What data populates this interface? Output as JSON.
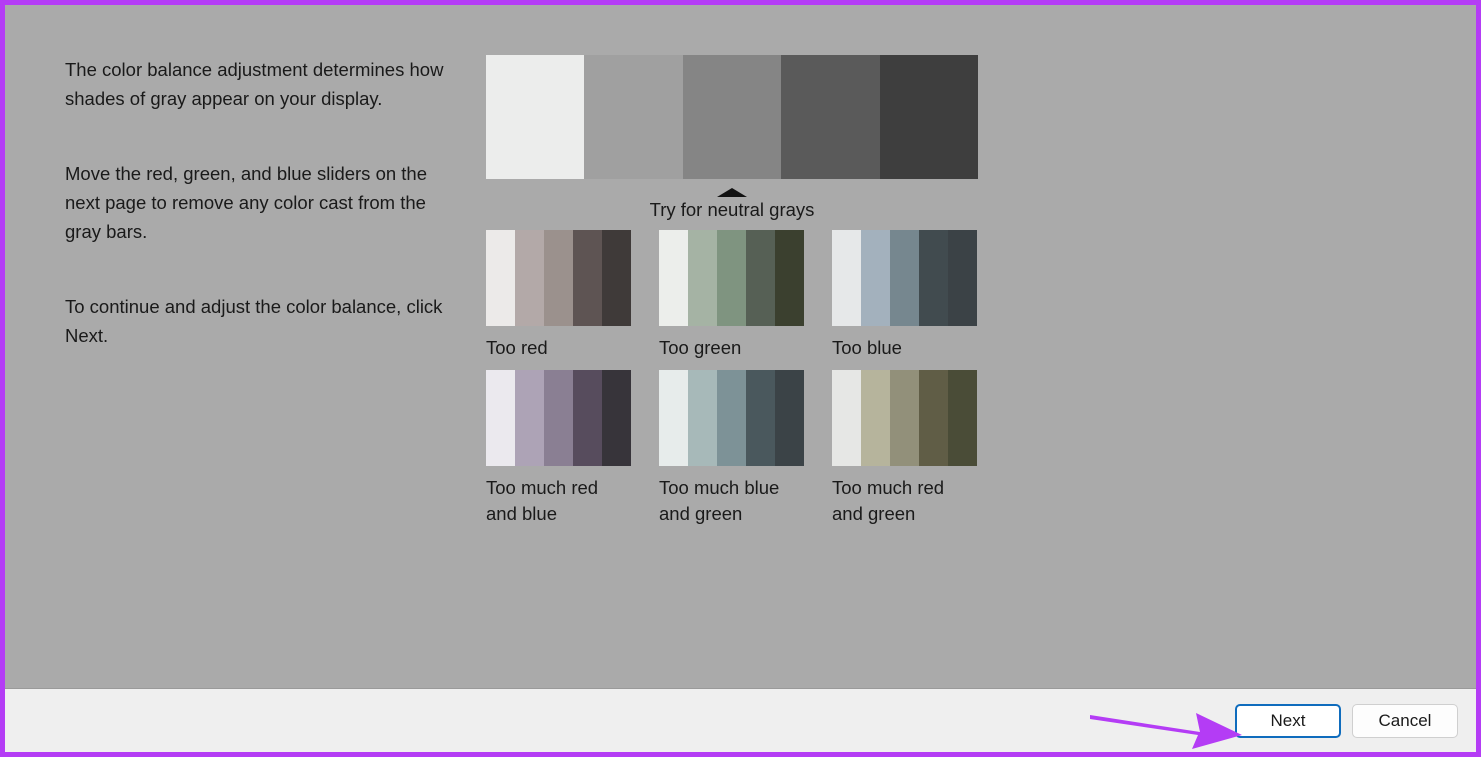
{
  "window": {
    "kind": "display-color-calibration-wizard",
    "annotation_frame_color": "#b43cf5",
    "body_background": "#aaaaaa",
    "footer_background": "#efefef"
  },
  "instructions": [
    "The color balance adjustment determines how shades of gray appear on your display.",
    "Move the red, green, and blue sliders on the next page to remove any color cast from the gray bars.",
    "To continue and adjust the color balance, click Next."
  ],
  "preview": {
    "main_strip": {
      "name": "neutral-gray-reference",
      "bars": [
        "#ecedec",
        "#a0a0a0",
        "#858585",
        "#5a5a5a",
        "#3e3e3e"
      ]
    },
    "neutral_caption": "Try for neutral grays",
    "caret_icon": "caret-up-icon",
    "samples": [
      {
        "label": "Too red",
        "name": "sample-too-red",
        "bars": [
          "#eceae9",
          "#b3a9a8",
          "#9b918d",
          "#5e5453",
          "#3f3a39"
        ]
      },
      {
        "label": "Too green",
        "name": "sample-too-green",
        "bars": [
          "#eceeeb",
          "#a5b3a4",
          "#7f9480",
          "#566055",
          "#3b402f"
        ]
      },
      {
        "label": "Too blue",
        "name": "sample-too-blue",
        "bars": [
          "#e6e8e9",
          "#a3b1bd",
          "#76878f",
          "#414b4f",
          "#3b4246"
        ]
      },
      {
        "label": "Too much red\nand blue",
        "name": "sample-too-much-red-and-blue",
        "bars": [
          "#ebe9ee",
          "#ada3b6",
          "#8a7f93",
          "#574c5d",
          "#37343a"
        ]
      },
      {
        "label": "Too much blue\nand green",
        "name": "sample-too-much-blue-and-green",
        "bars": [
          "#e7eceb",
          "#a7b9b9",
          "#7d9297",
          "#4a585d",
          "#3b4347"
        ]
      },
      {
        "label": "Too much red\nand green",
        "name": "sample-too-much-red-and-green",
        "bars": [
          "#e6e7e5",
          "#b6b49c",
          "#92907a",
          "#605d46",
          "#4a4c37"
        ]
      }
    ]
  },
  "footer": {
    "next_label": "Next",
    "cancel_label": "Cancel",
    "default_button": "Next",
    "default_border_color": "#0f6cbd"
  },
  "annotation": {
    "arrow_color": "#b43cf5",
    "arrow_points_to": "Next",
    "arrow_icon": "arrow-right-icon"
  }
}
